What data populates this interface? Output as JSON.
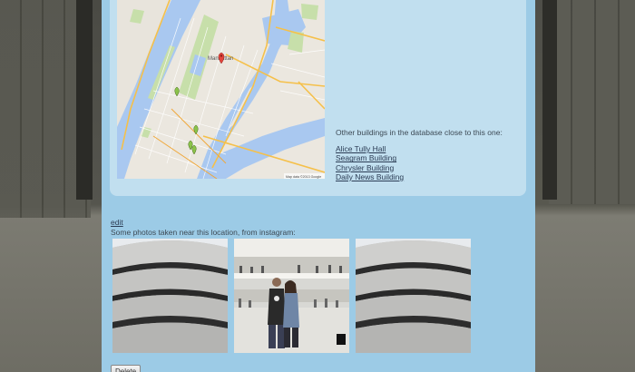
{
  "map": {
    "attribution": "Map data ©2013 Google",
    "district_label": "Manhattan"
  },
  "nearby": {
    "heading": "Other buildings in the database close to this one:",
    "buildings": [
      "Alice Tully Hall",
      "Seagram Building",
      "Chrysler Building",
      "Daily News Building"
    ]
  },
  "edit_label": "edit",
  "photos": {
    "caption": "Some photos taken near this location, from instagram:"
  },
  "delete_label": "Delete",
  "colors": {
    "page_panel": "#9ccbe6",
    "info_panel": "#c1dfef",
    "link": "#2c3d55",
    "water": "#a9c8f0",
    "park": "#c7dfaa"
  },
  "icons": [
    "map-marker-icon"
  ]
}
